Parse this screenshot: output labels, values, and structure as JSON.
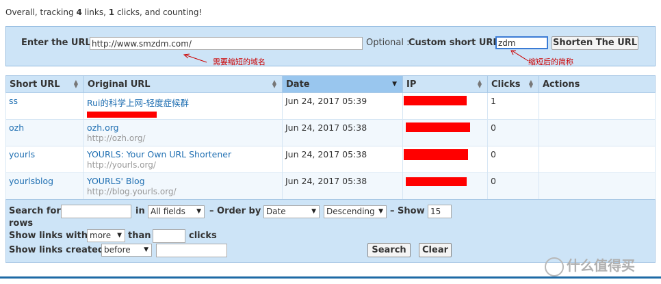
{
  "summary": {
    "prefix": "Overall, tracking",
    "links_count": "4",
    "links_word": "links,",
    "clicks_count": "1",
    "suffix": "clicks, and counting!"
  },
  "new_url": {
    "url_label": "Enter the URL",
    "url_value": "http://www.smzdm.com/",
    "optional_label": "Optional :",
    "custom_label": "Custom short URL",
    "custom_value": "zdm",
    "submit_label": "Shorten The URL",
    "annotation_url": "需要缩短的域名",
    "annotation_custom": "缩短后的简称"
  },
  "table": {
    "columns": [
      "Short URL",
      "Original URL",
      "Date",
      "IP",
      "Clicks",
      "Actions"
    ],
    "sorted_column": "Date",
    "rows": [
      {
        "short": "ss",
        "title": "Rui的科学上网-轻度症候群",
        "long": "",
        "date": "Jun 24, 2017 05:39",
        "clicks": "1"
      },
      {
        "short": "ozh",
        "title": "ozh.org",
        "long": "http://ozh.org/",
        "date": "Jun 24, 2017 05:38",
        "clicks": "0"
      },
      {
        "short": "yourls",
        "title": "YOURLS: Your Own URL Shortener",
        "long": "http://yourls.org/",
        "date": "Jun 24, 2017 05:38",
        "clicks": "0"
      },
      {
        "short": "yourlsblog",
        "title": "YOURLS' Blog",
        "long": "http://blog.yourls.org/",
        "date": "Jun 24, 2017 05:38",
        "clicks": "0"
      }
    ]
  },
  "filters": {
    "search_for": "Search for",
    "in": "in",
    "in_value": "All fields",
    "order_by": "– Order by",
    "order_value": "Date",
    "direction_value": "Descending",
    "show": "– Show",
    "show_value": "15",
    "rows": "rows",
    "show_links_with": "Show links with",
    "more_value": "more",
    "than": "than",
    "clicks": "clicks",
    "show_links_created": "Show links created",
    "before_value": "before",
    "search_button": "Search",
    "clear_button": "Clear"
  },
  "watermark": {
    "text": "什么值得买"
  },
  "colors": {
    "redact": "#ff0000",
    "header_bg": "#cde4f7",
    "link": "#1f6fb2",
    "annotation": "#cc0000"
  }
}
